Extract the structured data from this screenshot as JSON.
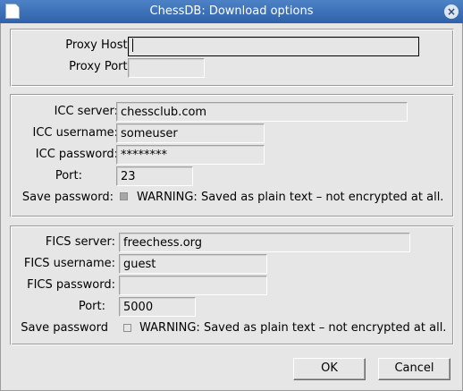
{
  "window": {
    "title": "ChessDB: Download options",
    "close_glyph": "×"
  },
  "proxy": {
    "host_label": "Proxy Host:",
    "host_value": "",
    "port_label": "Proxy Port:",
    "port_value": ""
  },
  "icc": {
    "server_label": "ICC server:",
    "server_value": "chessclub.com",
    "username_label": "ICC username:",
    "username_value": "someuser",
    "password_label": "ICC password:",
    "password_value": "********",
    "port_label": "Port:",
    "port_value": "23",
    "save_label": "Save password:",
    "save_checked": true,
    "warning": "WARNING: Saved as plain text – not encrypted at all."
  },
  "fics": {
    "server_label": "FICS server:",
    "server_value": "freechess.org",
    "username_label": "FICS username:",
    "username_value": "guest",
    "password_label": "FICS password:",
    "password_value": "",
    "port_label": "Port:",
    "port_value": "5000",
    "save_label": "Save password",
    "save_checked": false,
    "warning": "WARNING: Saved as plain text – not encrypted at all."
  },
  "buttons": {
    "ok": "OK",
    "cancel": "Cancel"
  }
}
